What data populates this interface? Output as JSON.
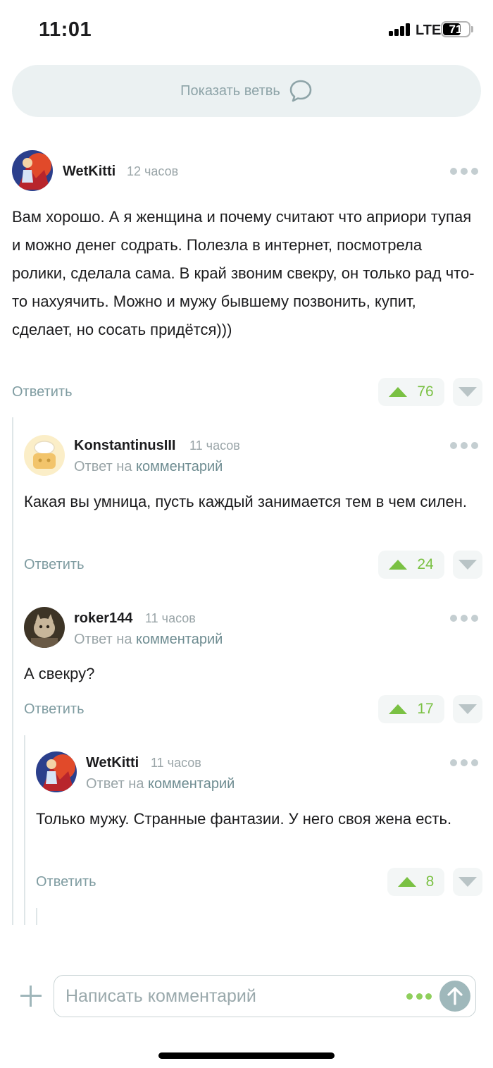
{
  "status_bar": {
    "time": "11:01",
    "network": "LTE",
    "battery": "71",
    "battery_level": 0.71
  },
  "thread": {
    "show_label": "Показать ветвь"
  },
  "comments": [
    {
      "author": "WetKitti",
      "time": "12 часов",
      "text": "Вам хорошо. А я женщина и почему считают что априори тупая и можно денег содрать. Полезла в интернет, посмотрела ролики, сделала сама. В край звоним свекру, он только рад что-то нахуячить. Можно и мужу бывшему позвонить, купит, сделает, но сосать придётся)))",
      "reply_label": "Ответить",
      "votes": "76"
    },
    {
      "author": "KonstantinusIII",
      "time": "11 часов",
      "reply_to_prefix": "Ответ на",
      "reply_to_link": "комментарий",
      "text": "Какая вы умница, пусть каждый занимается тем в чем силен.",
      "reply_label": "Ответить",
      "votes": "24"
    },
    {
      "author": "roker144",
      "time": "11 часов",
      "reply_to_prefix": "Ответ на",
      "reply_to_link": "комментарий",
      "text": "А свекру?",
      "reply_label": "Ответить",
      "votes": "17"
    },
    {
      "author": "WetKitti",
      "time": "11 часов",
      "reply_to_prefix": "Ответ на",
      "reply_to_link": "комментарий",
      "text": "Только мужу. Странные фантазии. У него своя жена есть.",
      "reply_label": "Ответить",
      "votes": "8"
    }
  ],
  "composer": {
    "placeholder": "Написать комментарий"
  },
  "colors": {
    "accent_green": "#7ac143",
    "muted_teal": "#7f9ca1",
    "pill_bg": "#ebf1f2"
  }
}
